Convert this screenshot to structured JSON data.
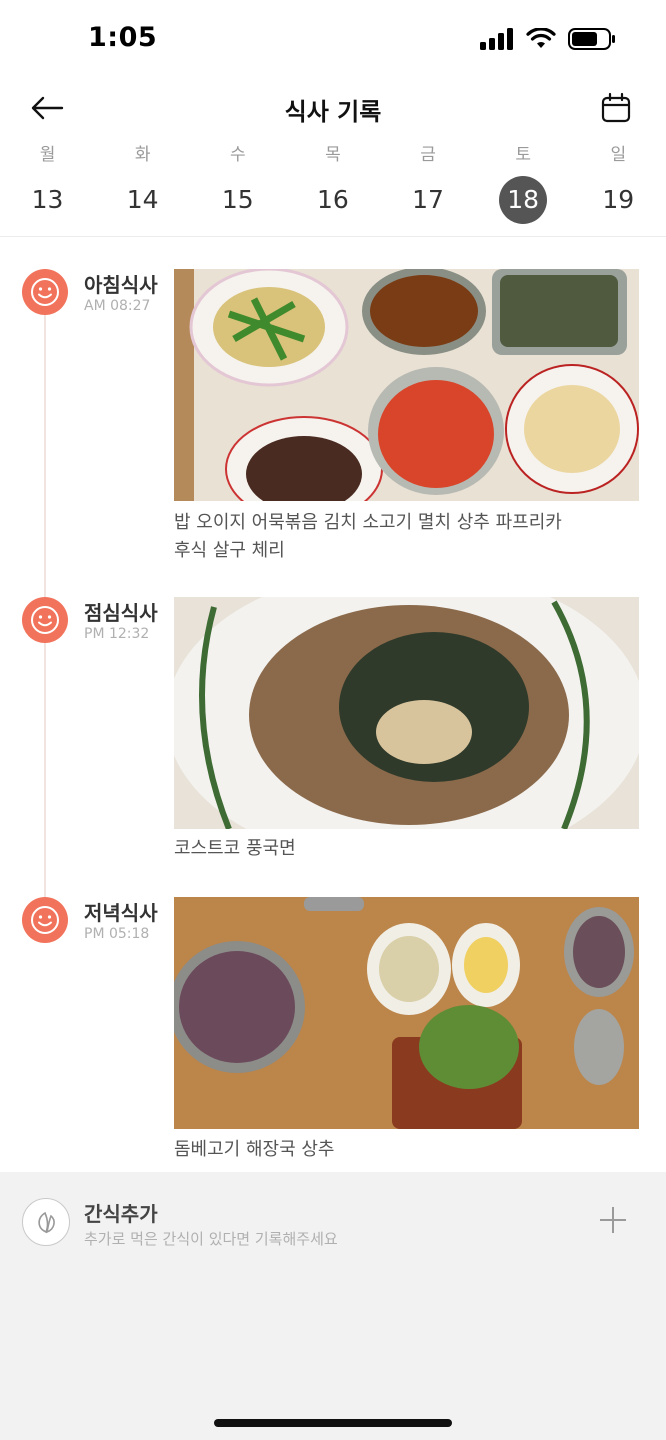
{
  "status_bar": {
    "time": "1:05"
  },
  "header": {
    "title": "식사 기록"
  },
  "week": {
    "days": [
      {
        "label": "월",
        "date": "13"
      },
      {
        "label": "화",
        "date": "14"
      },
      {
        "label": "수",
        "date": "15"
      },
      {
        "label": "목",
        "date": "16"
      },
      {
        "label": "금",
        "date": "17"
      },
      {
        "label": "토",
        "date": "18"
      },
      {
        "label": "일",
        "date": "19"
      }
    ],
    "selected_date": "18"
  },
  "meals": [
    {
      "name": "아침식사",
      "time": "AM 08:27",
      "description_line1": "밥 오이지 어묵볶음 김치 소고기 멸치 상추 파프리카",
      "description_line2": "후식 살구 체리"
    },
    {
      "name": "점심식사",
      "time": "PM 12:32",
      "description_line1": "코스트코 풍국면",
      "description_line2": ""
    },
    {
      "name": "저녁식사",
      "time": "PM 05:18",
      "description_line1": "돔베고기 해장국 상추",
      "description_line2": ""
    }
  ],
  "snack": {
    "title": "간식추가",
    "subtitle": "추가로 먹은 간식이 있다면 기록해주세요"
  },
  "colors": {
    "accent": "#f2735c",
    "selected_day": "#555555"
  }
}
